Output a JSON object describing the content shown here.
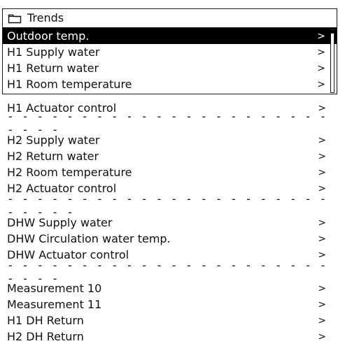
{
  "window": {
    "title": "Trends"
  },
  "items": [
    {
      "label": "Outdoor temp.",
      "chevron": ">",
      "selected": true
    },
    {
      "label": "H1 Supply water",
      "chevron": ">"
    },
    {
      "label": "H1 Return water",
      "chevron": ">"
    },
    {
      "label": "H1 Room temperature",
      "chevron": ">"
    },
    {
      "label": "H1 Actuator control",
      "chevron": ">"
    },
    {
      "label": "H2 Supply water",
      "chevron": ">"
    },
    {
      "label": "H2 Return water",
      "chevron": ">"
    },
    {
      "label": "H2 Room temperature",
      "chevron": ">"
    },
    {
      "label": "H2 Actuator control",
      "chevron": ">"
    },
    {
      "label": "DHW Supply water",
      "chevron": ">"
    },
    {
      "label": "DHW Circulation water temp.",
      "chevron": ">"
    },
    {
      "label": "DHW Actuator control",
      "chevron": ">"
    },
    {
      "label": "Measurement 10",
      "chevron": ">"
    },
    {
      "label": "Measurement 11",
      "chevron": ">"
    },
    {
      "label": "H1 DH Return",
      "chevron": ">"
    },
    {
      "label": "H2 DH Return",
      "chevron": ">"
    }
  ],
  "dividers": [
    "- - - - - - - - - - - - - - - - - - - - - - - - - -",
    "- - - - - - - - - - - - - - - - - - - - - - - - - - -",
    "- - - - - - - - - - - - - - - - - - - - - - - - - -"
  ],
  "icons": {
    "folder": "folder-icon",
    "scrollbar": "scrollbar"
  }
}
